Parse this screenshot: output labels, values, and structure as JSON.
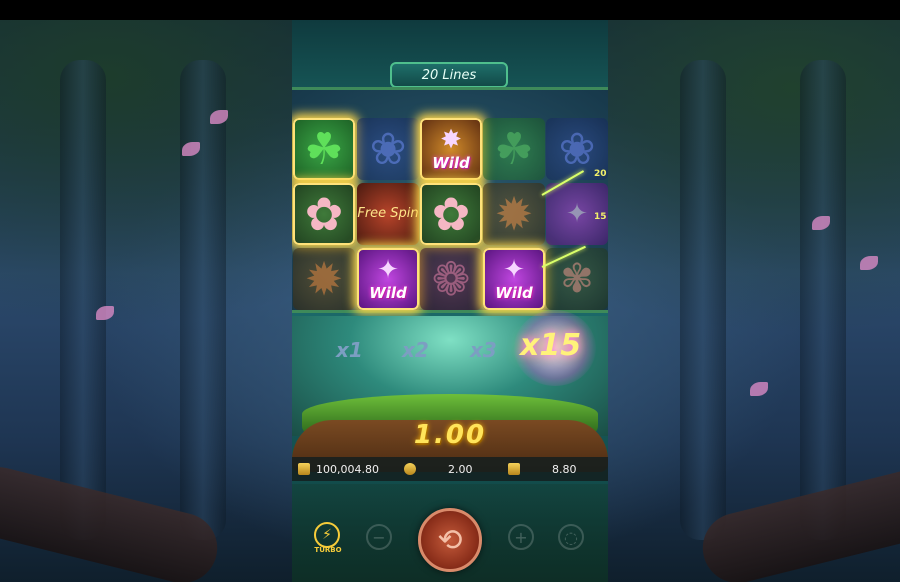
{
  "game": {
    "lines_label": "20 Lines",
    "reels": [
      [
        "clover",
        "pinkflower",
        "orangeflower"
      ],
      [
        "blueflower",
        "freespin",
        "wild-b"
      ],
      [
        "wild-g",
        "pinkflower",
        "rose"
      ],
      [
        "clover",
        "orangeflower",
        "wild-b"
      ],
      [
        "blueflower",
        "wild-b",
        "peach"
      ]
    ],
    "symbol_texts": {
      "wild": "Wild",
      "free_spin": "Free Spin"
    },
    "paylines": [
      "20",
      "15"
    ],
    "multipliers": [
      "x1",
      "x2",
      "x3",
      "x15"
    ],
    "active_multiplier": "x15",
    "win_amount": "1.00",
    "balance": "100,004.80",
    "bet": "2.00",
    "last_win": "8.80",
    "turbo_label": "TURBO"
  },
  "icons": {
    "balance": "wallet-icon",
    "bet": "coin-icon",
    "win": "trophy-icon",
    "turbo": "lightning-icon",
    "spin": "spin-arrows-icon"
  }
}
